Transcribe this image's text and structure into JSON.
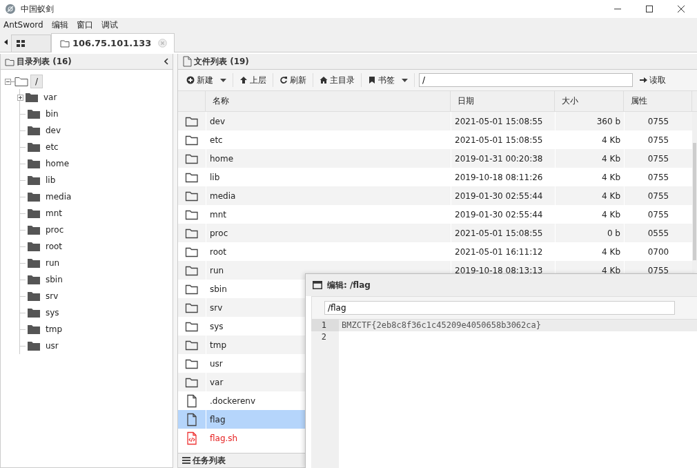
{
  "window": {
    "title": "中国蚁剑"
  },
  "menu": [
    "AntSword",
    "编辑",
    "窗口",
    "调试"
  ],
  "tabs": [
    {
      "kind": "grid",
      "selected": false
    },
    {
      "kind": "host",
      "label": "106.75.101.133",
      "selected": true
    }
  ],
  "directory_panel": {
    "title": "目录列表 (16)",
    "tree": {
      "label": "/",
      "expanded": true,
      "children": [
        {
          "label": "var",
          "expandable": true
        },
        {
          "label": "bin",
          "expandable": false
        },
        {
          "label": "dev",
          "expandable": false
        },
        {
          "label": "etc",
          "expandable": false
        },
        {
          "label": "home",
          "expandable": false
        },
        {
          "label": "lib",
          "expandable": false
        },
        {
          "label": "media",
          "expandable": false
        },
        {
          "label": "mnt",
          "expandable": false
        },
        {
          "label": "proc",
          "expandable": false
        },
        {
          "label": "root",
          "expandable": false
        },
        {
          "label": "run",
          "expandable": false
        },
        {
          "label": "sbin",
          "expandable": false
        },
        {
          "label": "srv",
          "expandable": false
        },
        {
          "label": "sys",
          "expandable": false
        },
        {
          "label": "tmp",
          "expandable": false
        },
        {
          "label": "usr",
          "expandable": false
        }
      ]
    }
  },
  "file_panel": {
    "title": "文件列表 (19)",
    "toolbar": [
      {
        "kind": "new",
        "label": "新建",
        "dropdown": true
      },
      {
        "kind": "up",
        "label": "上层",
        "dropdown": false
      },
      {
        "kind": "refresh",
        "label": "刷新",
        "dropdown": false
      },
      {
        "kind": "home",
        "label": "主目录",
        "dropdown": false
      },
      {
        "kind": "bookmark",
        "label": "书签",
        "dropdown": true
      }
    ],
    "path": "/",
    "read_button": "读取",
    "columns": [
      "名称",
      "日期",
      "大小",
      "属性"
    ],
    "rows": [
      {
        "kind": "folder",
        "name": "dev",
        "date": "2021-05-01 15:08:55",
        "size": "360 b",
        "mode": "0755",
        "selected": false
      },
      {
        "kind": "folder",
        "name": "etc",
        "date": "2021-05-01 15:08:55",
        "size": "4 Kb",
        "mode": "0755",
        "selected": false
      },
      {
        "kind": "folder",
        "name": "home",
        "date": "2019-01-31 00:20:38",
        "size": "4 Kb",
        "mode": "0755",
        "selected": false
      },
      {
        "kind": "folder",
        "name": "lib",
        "date": "2019-10-18 08:11:26",
        "size": "4 Kb",
        "mode": "0755",
        "selected": false
      },
      {
        "kind": "folder",
        "name": "media",
        "date": "2019-01-30 02:55:44",
        "size": "4 Kb",
        "mode": "0755",
        "selected": false
      },
      {
        "kind": "folder",
        "name": "mnt",
        "date": "2019-01-30 02:55:44",
        "size": "4 Kb",
        "mode": "0755",
        "selected": false
      },
      {
        "kind": "folder",
        "name": "proc",
        "date": "2021-05-01 15:08:55",
        "size": "0 b",
        "mode": "0555",
        "selected": false
      },
      {
        "kind": "folder",
        "name": "root",
        "date": "2021-05-01 16:11:12",
        "size": "4 Kb",
        "mode": "0700",
        "selected": false
      },
      {
        "kind": "folder",
        "name": "run",
        "date": "2019-10-18 08:13:13",
        "size": "4 Kb",
        "mode": "0755",
        "selected": false
      },
      {
        "kind": "folder",
        "name": "sbin",
        "selected": false
      },
      {
        "kind": "folder",
        "name": "srv",
        "selected": false
      },
      {
        "kind": "folder",
        "name": "sys",
        "selected": false
      },
      {
        "kind": "folder",
        "name": "tmp",
        "selected": false
      },
      {
        "kind": "folder",
        "name": "usr",
        "selected": false
      },
      {
        "kind": "folder",
        "name": "var",
        "selected": false
      },
      {
        "kind": "file",
        "name": ".dockerenv",
        "selected": false
      },
      {
        "kind": "file",
        "name": "flag",
        "selected": true
      },
      {
        "kind": "script",
        "name": "flag.sh",
        "selected": false
      }
    ]
  },
  "task_panel": {
    "title": "任务列表"
  },
  "editor": {
    "title": "编辑: /flag",
    "path": "/flag",
    "lines": [
      {
        "number": "1",
        "text": "BMZCTF{2eb8c8f36c1c45209e4050658b3062ca}",
        "active": true
      },
      {
        "number": "2",
        "active": false
      }
    ]
  }
}
